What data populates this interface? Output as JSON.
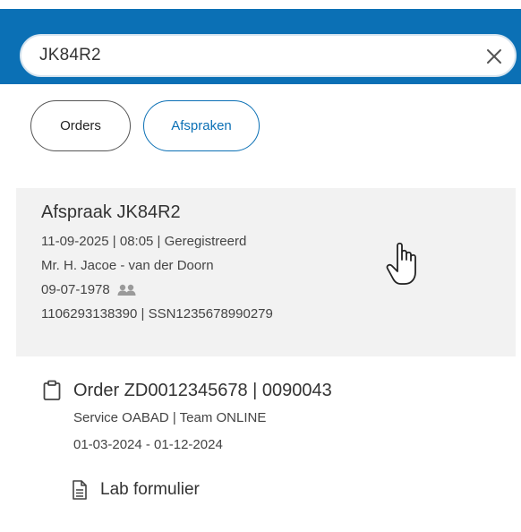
{
  "search": {
    "value": "JK84R2",
    "clear_icon": "close-icon"
  },
  "filters": [
    {
      "label": "Orders",
      "active": false
    },
    {
      "label": "Afspraken",
      "active": true
    }
  ],
  "appointment": {
    "title": "Afspraak JK84R2",
    "datetime_status": "11-09-2025  | 08:05 | Geregistreerd",
    "patient_name": "Mr. H. Jacoe - van der Doorn",
    "birth_date": "09-07-1978",
    "ids": "1106293138390 | SSN1235678990279",
    "icon": "people-icon"
  },
  "order": {
    "icon": "clipboard-icon",
    "title": "Order ZD0012345678  | 0090043",
    "service_team": "Service OABAD | Team ONLINE",
    "period": "01-03-2024 - 01-12-2024",
    "lab_form": {
      "icon": "document-icon",
      "label": "Lab formulier"
    }
  },
  "colors": {
    "brand_blue": "#0B70B5",
    "highlight_bg": "#f2f2f2"
  }
}
